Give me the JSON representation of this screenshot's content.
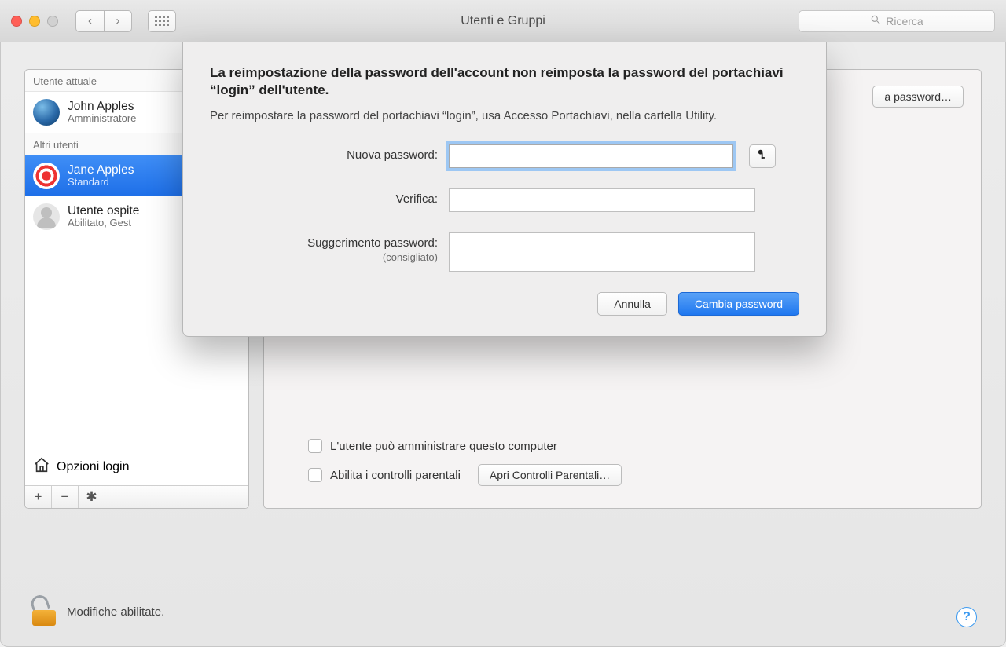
{
  "window": {
    "title": "Utenti e Gruppi",
    "search_placeholder": "Ricerca"
  },
  "sidebar": {
    "current_header": "Utente attuale",
    "others_header": "Altri utenti",
    "users": [
      {
        "name": "John Apples",
        "role": "Amministratore"
      },
      {
        "name": "Jane Apples",
        "role": "Standard"
      },
      {
        "name": "Utente ospite",
        "role": "Abilitato, Gest"
      }
    ],
    "login_options": "Opzioni login"
  },
  "main": {
    "reset_password_button": "a password…",
    "admin_checkbox": "L'utente può amministrare questo computer",
    "parental_checkbox": "Abilita i controlli parentali",
    "open_parental_button": "Apri Controlli Parentali…"
  },
  "lockrow": {
    "text": "Modifiche abilitate."
  },
  "sheet": {
    "heading": "La reimpostazione della password dell'account non reimposta la password del portachiavi “login” dell'utente.",
    "subtext": "Per reimpostare la password del portachiavi “login”, usa Accesso Portachiavi, nella cartella Utility.",
    "labels": {
      "new_password": "Nuova password:",
      "verify": "Verifica:",
      "hint": "Suggerimento password:",
      "hint_sub": "(consigliato)"
    },
    "values": {
      "new_password": "",
      "verify": "",
      "hint": ""
    },
    "buttons": {
      "cancel": "Annulla",
      "confirm": "Cambia password"
    }
  }
}
